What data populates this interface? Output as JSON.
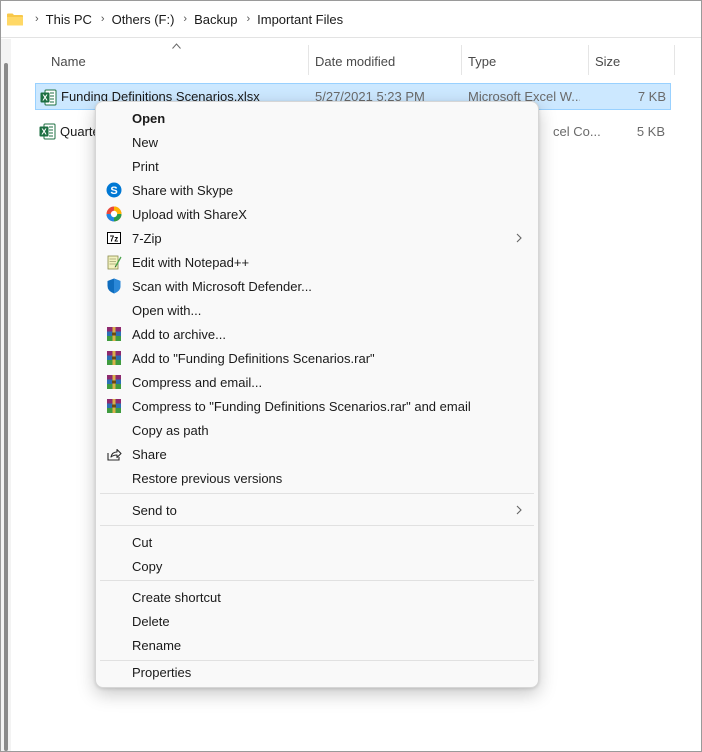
{
  "breadcrumb": [
    "This PC",
    "Others (F:)",
    "Backup",
    "Important Files"
  ],
  "columns": {
    "name": "Name",
    "date_modified": "Date modified",
    "type": "Type",
    "size": "Size"
  },
  "files": [
    {
      "name": "Funding Definitions Scenarios.xlsx",
      "date_modified": "5/27/2021 5:23 PM",
      "type": "Microsoft Excel W...",
      "size": "7 KB",
      "selected": true
    },
    {
      "name": "Quarte",
      "date_modified": "",
      "type": "cel Co...",
      "size": "5 KB",
      "selected": false
    }
  ],
  "context_menu": {
    "groups": [
      [
        {
          "label": "Open",
          "icon": "",
          "bold": true
        },
        {
          "label": "New",
          "icon": ""
        },
        {
          "label": "Print",
          "icon": ""
        },
        {
          "label": "Share with Skype",
          "icon": "skype-icon"
        },
        {
          "label": "Upload with ShareX",
          "icon": "sharex-icon"
        },
        {
          "label": "7-Zip",
          "icon": "7zip-icon",
          "submenu": true
        },
        {
          "label": "Edit with Notepad++",
          "icon": "notepadpp-icon"
        },
        {
          "label": "Scan with Microsoft Defender...",
          "icon": "defender-icon"
        },
        {
          "label": "Open with...",
          "icon": ""
        },
        {
          "label": "Add to archive...",
          "icon": "winrar-icon"
        },
        {
          "label": "Add to \"Funding Definitions Scenarios.rar\"",
          "icon": "winrar-icon"
        },
        {
          "label": "Compress and email...",
          "icon": "winrar-icon"
        },
        {
          "label": "Compress to \"Funding Definitions Scenarios.rar\" and email",
          "icon": "winrar-icon"
        },
        {
          "label": "Copy as path",
          "icon": ""
        },
        {
          "label": "Share",
          "icon": "share-icon"
        },
        {
          "label": "Restore previous versions",
          "icon": ""
        }
      ],
      [
        {
          "label": "Send to",
          "icon": "",
          "submenu": true
        }
      ],
      [
        {
          "label": "Cut",
          "icon": ""
        },
        {
          "label": "Copy",
          "icon": ""
        }
      ],
      [
        {
          "label": "Create shortcut",
          "icon": ""
        },
        {
          "label": "Delete",
          "icon": ""
        },
        {
          "label": "Rename",
          "icon": ""
        }
      ],
      [
        {
          "label": "Properties",
          "icon": ""
        }
      ]
    ]
  },
  "colors": {
    "selection_bg": "#cce8ff",
    "selection_border": "#99d1ff",
    "excel_green": "#1d6f42",
    "folder_yellow": "#f8c84a"
  }
}
